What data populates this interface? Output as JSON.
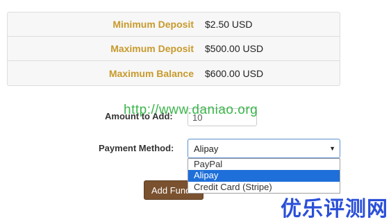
{
  "limits": [
    {
      "label": "Minimum Deposit",
      "value": "$2.50 USD"
    },
    {
      "label": "Maximum Deposit",
      "value": "$500.00 USD"
    },
    {
      "label": "Maximum Balance",
      "value": "$600.00 USD"
    }
  ],
  "form": {
    "amount_label": "Amount to Add:",
    "amount_value": "10",
    "payment_label": "Payment Method:",
    "payment_selected": "Alipay",
    "payment_options": [
      "PayPal",
      "Alipay",
      "Credit Card (Stripe)"
    ],
    "submit_label": "Add Funds"
  },
  "watermarks": {
    "url": "http://www.daniao.org",
    "site_name": "优乐评测网"
  },
  "colors": {
    "label_gold": "#c79a2c",
    "button_brown": "#7a5230",
    "selection_blue": "#1e6fd9",
    "watermark_green": "#3ab54a",
    "watermark_blue": "#2a4fd8"
  }
}
